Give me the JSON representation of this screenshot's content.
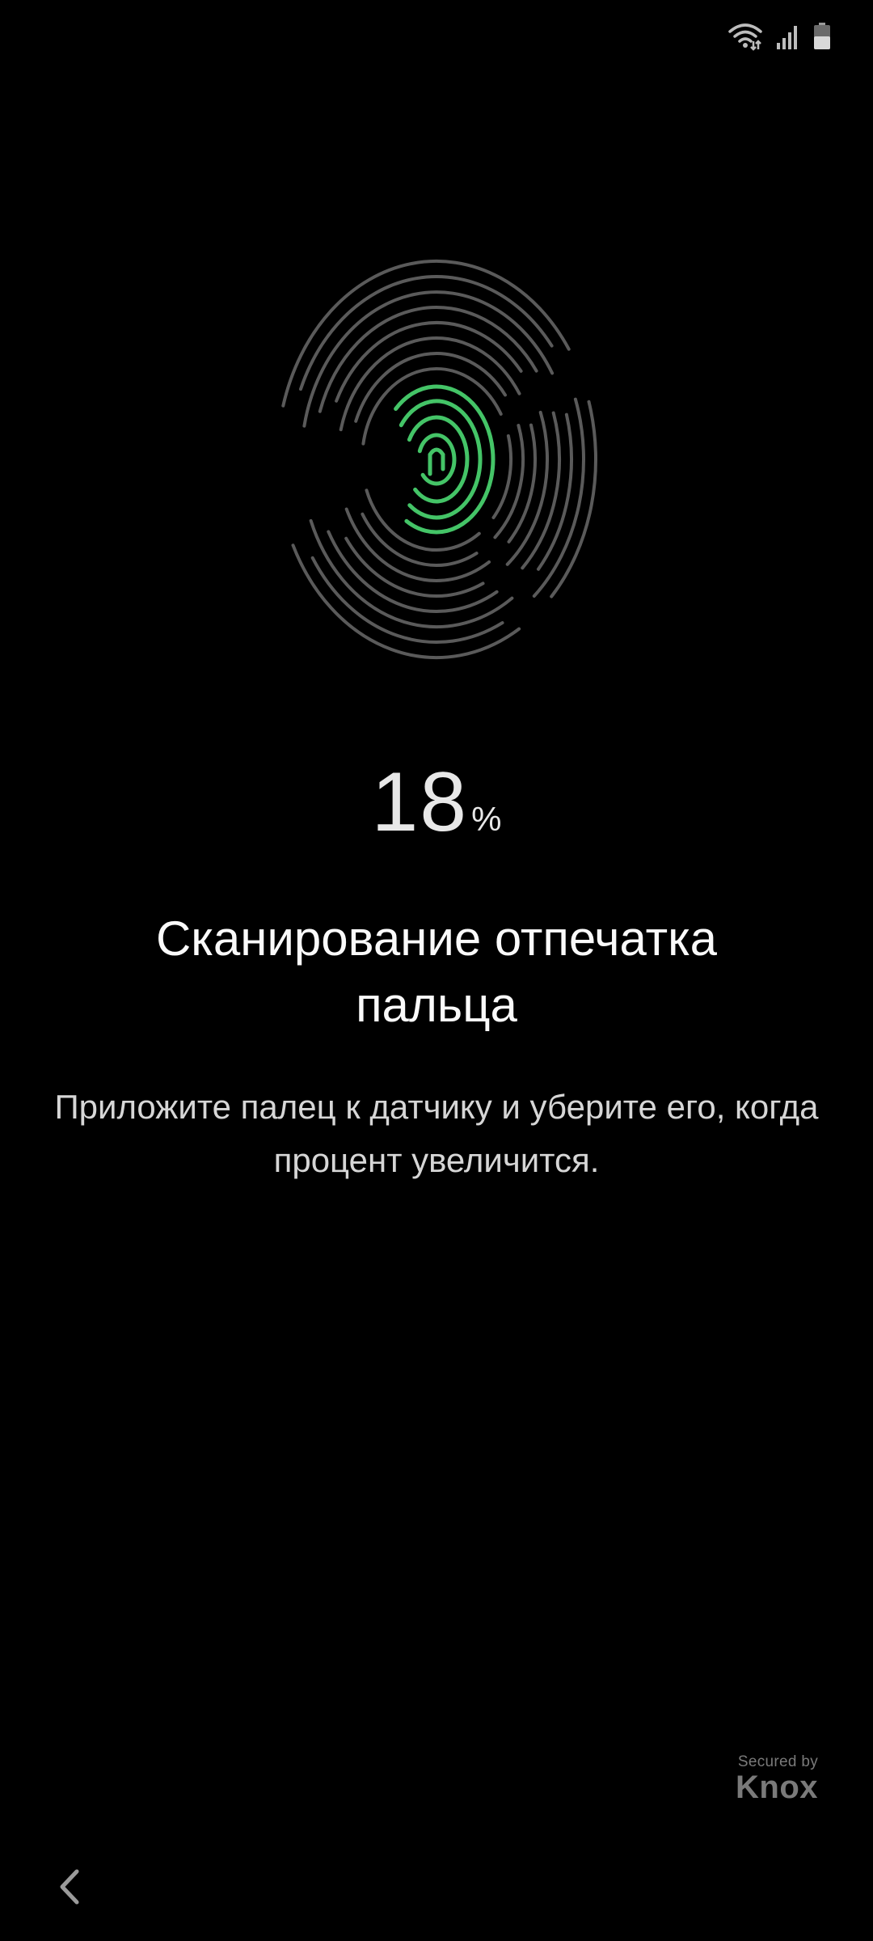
{
  "status_bar": {
    "icons": [
      "wifi-icon",
      "signal-icon",
      "battery-icon"
    ]
  },
  "fingerprint": {
    "icon": "fingerprint-icon",
    "colors": {
      "ridges": "#5a5a5a",
      "progress": "#44c467"
    }
  },
  "progress": {
    "value": "18",
    "unit": "%"
  },
  "title": "Сканирование отпечатка пальца",
  "description": "Приложите палец к датчику и уберите его, когда процент увеличится.",
  "knox": {
    "secured_by": "Secured by",
    "brand": "Knox"
  },
  "nav": {
    "back_icon": "chevron-left-icon"
  }
}
